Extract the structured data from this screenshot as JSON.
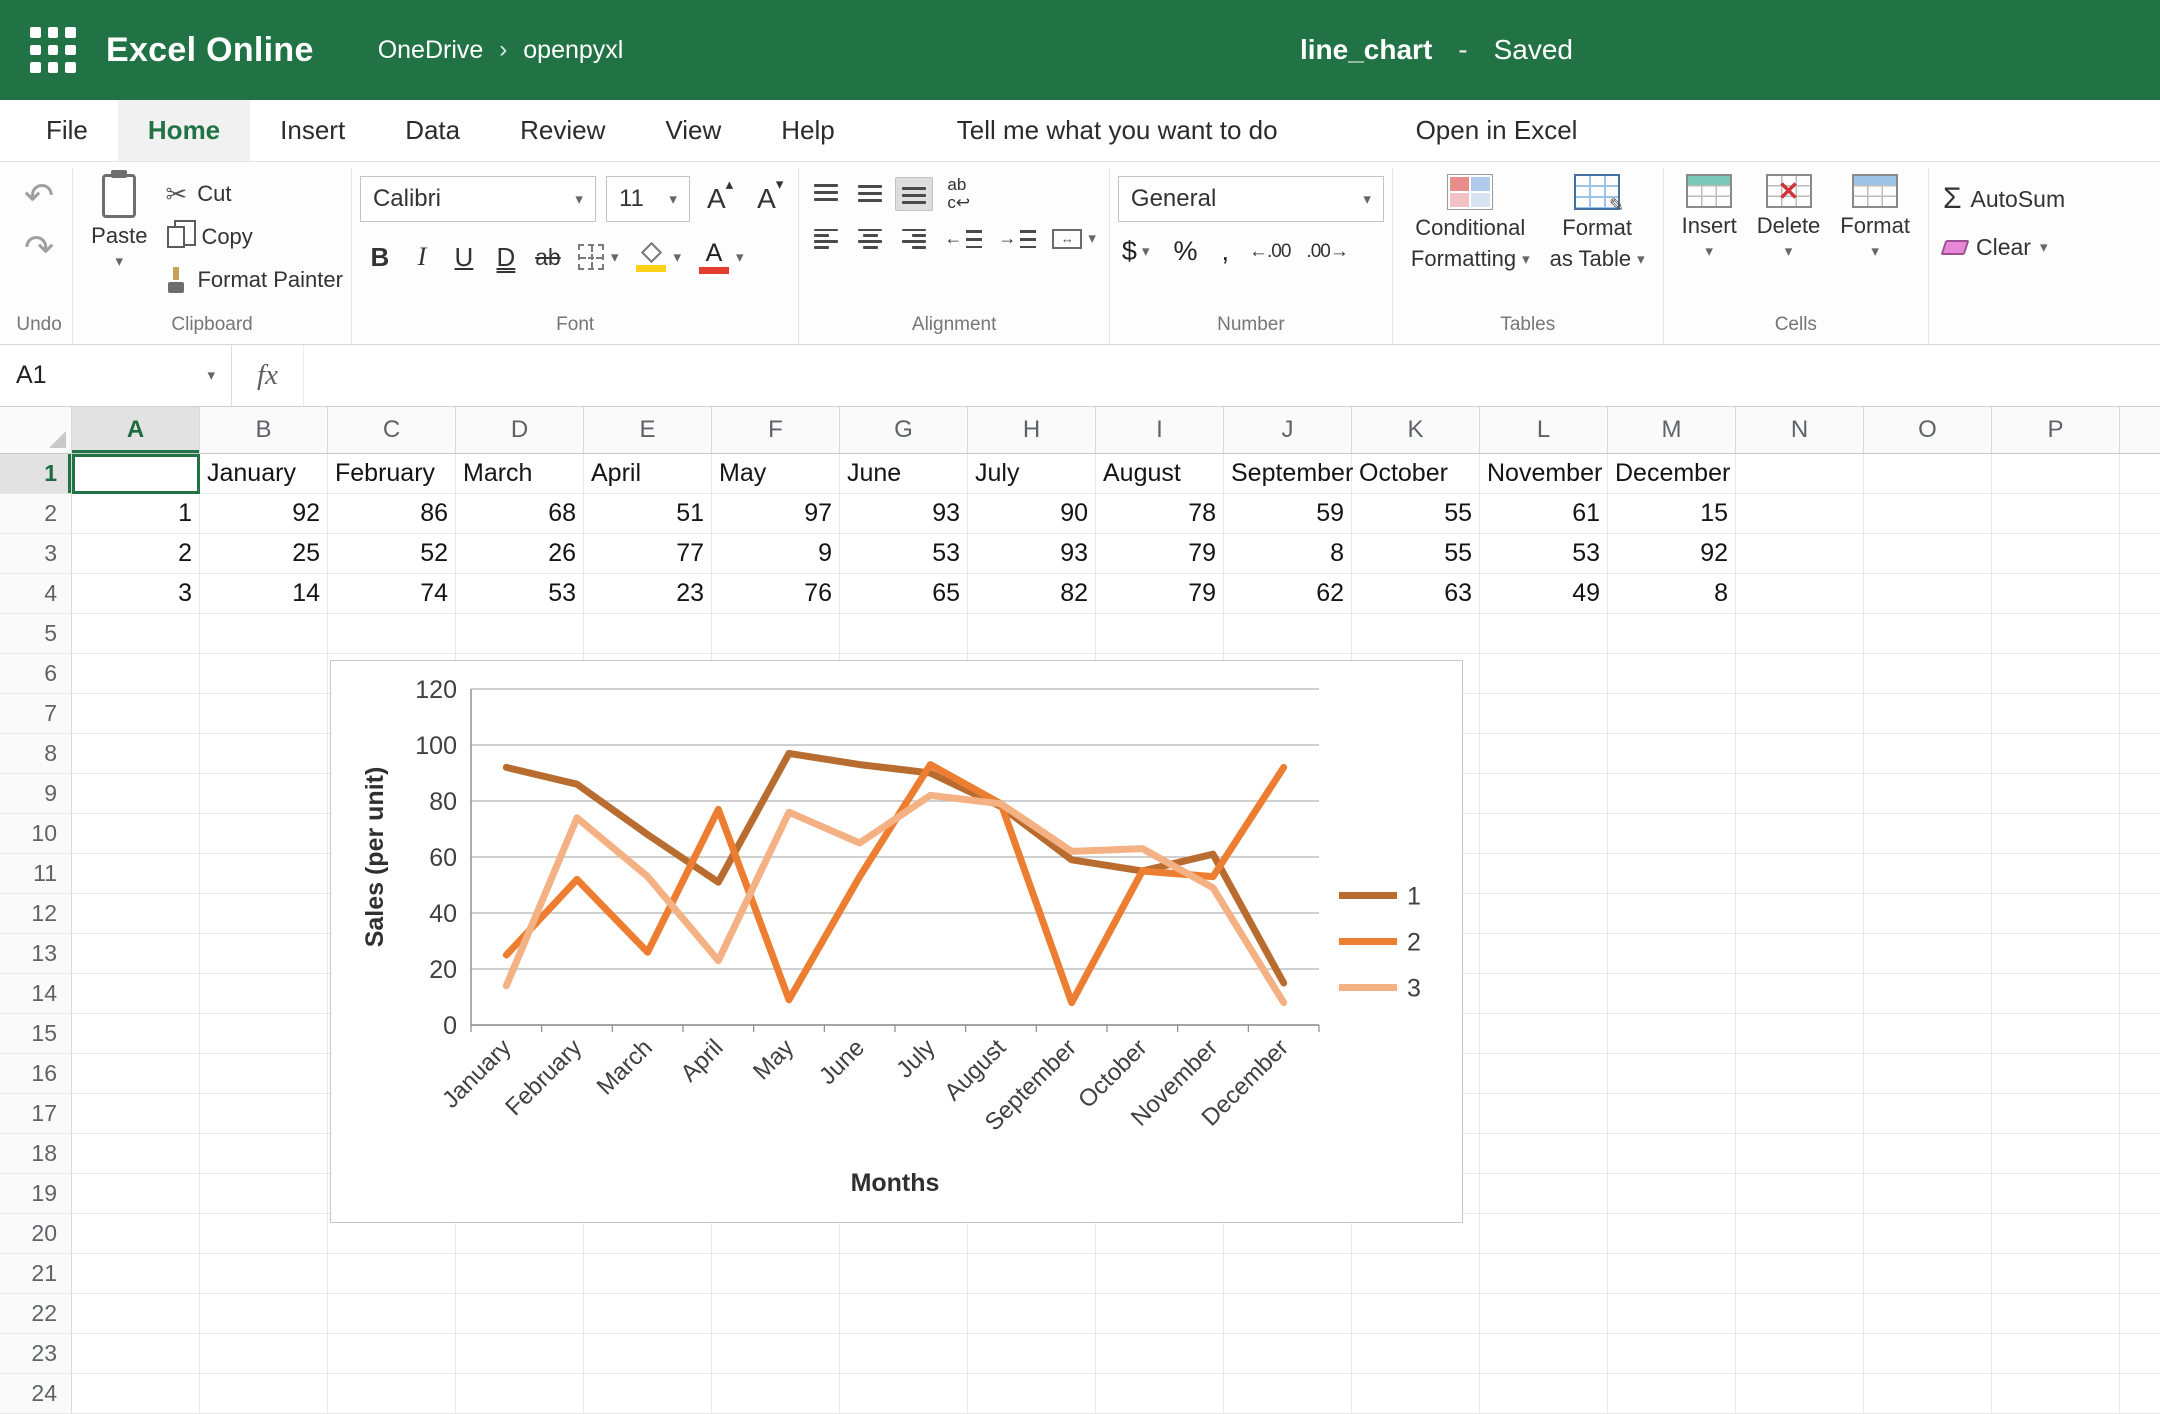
{
  "header": {
    "app_title": "Excel Online",
    "breadcrumb_1": "OneDrive",
    "breadcrumb_2": "openpyxl",
    "file_name": "line_chart",
    "file_sep": "-",
    "save_status": "Saved"
  },
  "menu": {
    "file": "File",
    "home": "Home",
    "insert": "Insert",
    "data": "Data",
    "review": "Review",
    "view": "View",
    "help": "Help",
    "tell_me": "Tell me what you want to do",
    "open_in_excel": "Open in Excel"
  },
  "icons": {
    "undo": "↶",
    "redo": "↷",
    "cut": "✂",
    "dropdown": "▾",
    "caret_up": "▴",
    "chevron": "›",
    "grow_letter": "A",
    "shrink_letter": "A",
    "font_color_letter": "A",
    "wrap_top": "ab",
    "wrap_bottom": "c↩",
    "merge_arrows": "↔",
    "indent_out": "←",
    "indent_in": "→",
    "sigma": "Σ"
  },
  "ribbon": {
    "labels": {
      "undo": "Undo",
      "clipboard": "Clipboard",
      "font": "Font",
      "alignment": "Alignment",
      "number": "Number",
      "tables": "Tables",
      "cells": "Cells"
    },
    "clipboard": {
      "paste": "Paste",
      "cut": "Cut",
      "copy": "Copy",
      "format_painter": "Format Painter"
    },
    "font": {
      "family": "Calibri",
      "size": "11",
      "bold": "B",
      "italic": "I",
      "underline": "U",
      "double_underline": "D",
      "strikethrough": "ab"
    },
    "number": {
      "format": "General",
      "currency": "$",
      "percent": "%",
      "comma": ",",
      "inc_decimal": "←.00",
      "dec_decimal": ".00→"
    },
    "tables": {
      "conditional_1": "Conditional",
      "conditional_2": "Formatting",
      "format_1": "Format",
      "format_2": "as Table"
    },
    "cells": {
      "insert": "Insert",
      "delete": "Delete",
      "format": "Format"
    },
    "editing": {
      "autosum": "AutoSum",
      "clear": "Clear"
    }
  },
  "formula_bar": {
    "name_box": "A1",
    "fx": "fx",
    "content": ""
  },
  "sheet": {
    "columns": [
      "A",
      "B",
      "C",
      "D",
      "E",
      "F",
      "G",
      "H",
      "I",
      "J",
      "K",
      "L",
      "M",
      "N",
      "O",
      "P"
    ],
    "row_count": 24,
    "selected": {
      "col": "A",
      "row": 1
    },
    "rows": [
      [
        "",
        "January",
        "February",
        "March",
        "April",
        "May",
        "June",
        "July",
        "August",
        "September",
        "October",
        "November",
        "December",
        "",
        "",
        ""
      ],
      [
        "1",
        "92",
        "86",
        "68",
        "51",
        "97",
        "93",
        "90",
        "78",
        "59",
        "55",
        "61",
        "15",
        "",
        "",
        ""
      ],
      [
        "2",
        "25",
        "52",
        "26",
        "77",
        "9",
        "53",
        "93",
        "79",
        "8",
        "55",
        "53",
        "92",
        "",
        "",
        ""
      ],
      [
        "3",
        "14",
        "74",
        "53",
        "23",
        "76",
        "65",
        "82",
        "79",
        "62",
        "63",
        "49",
        "8",
        "",
        "",
        ""
      ]
    ]
  },
  "chart_data": {
    "type": "line",
    "title": "",
    "xlabel": "Months",
    "ylabel": "Sales (per unit)",
    "ylim": [
      0,
      120
    ],
    "yticks": [
      0,
      20,
      40,
      60,
      80,
      100,
      120
    ],
    "grid": true,
    "legend_position": "right",
    "categories": [
      "January",
      "February",
      "March",
      "April",
      "May",
      "June",
      "July",
      "August",
      "September",
      "October",
      "November",
      "December"
    ],
    "series": [
      {
        "name": "1",
        "color": "#b96c2f",
        "values": [
          92,
          86,
          68,
          51,
          97,
          93,
          90,
          78,
          59,
          55,
          61,
          15
        ]
      },
      {
        "name": "2",
        "color": "#ed7d31",
        "values": [
          25,
          52,
          26,
          77,
          9,
          53,
          93,
          79,
          8,
          55,
          53,
          92
        ]
      },
      {
        "name": "3",
        "color": "#f4b183",
        "values": [
          14,
          74,
          53,
          23,
          76,
          65,
          82,
          79,
          62,
          63,
          49,
          8
        ]
      }
    ]
  }
}
